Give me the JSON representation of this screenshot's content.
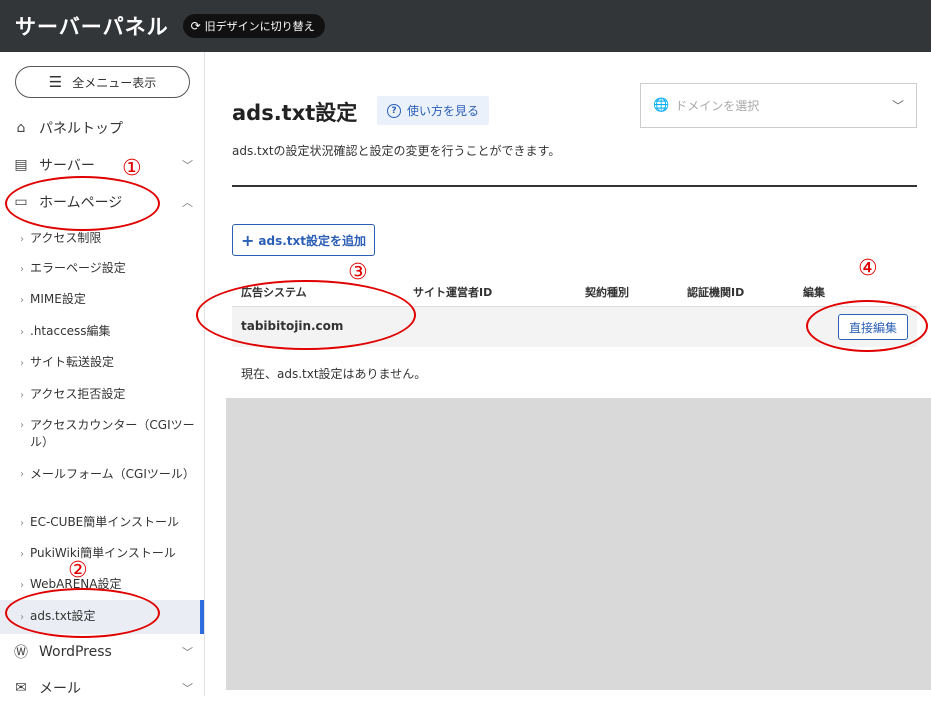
{
  "header": {
    "title": "サーバーパネル",
    "old_design_label": "旧デザインに切り替え"
  },
  "sidebar": {
    "menu_button": "全メニュー表示",
    "panel_top": "パネルトップ",
    "server": "サーバー",
    "homepage": "ホームページ",
    "subitems": [
      "アクセス制限",
      "エラーページ設定",
      "MIME設定",
      ".htaccess編集",
      "サイト転送設定",
      "アクセス拒否設定",
      "アクセスカウンター（CGIツール）",
      "メールフォーム（CGIツール）",
      "EC-CUBE簡単インストール",
      "PukiWiki簡単インストール",
      "WebARENA設定",
      "ads.txt設定"
    ],
    "wordpress": "WordPress",
    "mail": "メール"
  },
  "main": {
    "title": "ads.txt設定",
    "howto": "使い方を見る",
    "domain_placeholder": "ドメインを選択",
    "description": "ads.txtの設定状況確認と設定の変更を行うことができます。",
    "add_button": "ads.txt設定を追加",
    "columns": [
      "広告システム",
      "サイト運営者ID",
      "契約種別",
      "認証機関ID",
      "編集"
    ],
    "domain": "tabibitojin.com",
    "edit_button": "直接編集",
    "empty_message": "現在、ads.txt設定はありません。"
  },
  "annotations": [
    "①",
    "②",
    "③",
    "④"
  ],
  "colors": {
    "topbar": "#333639",
    "accent": "#2b5fb5",
    "annotation": "#e00000",
    "active_bar": "#2d6cdf"
  }
}
